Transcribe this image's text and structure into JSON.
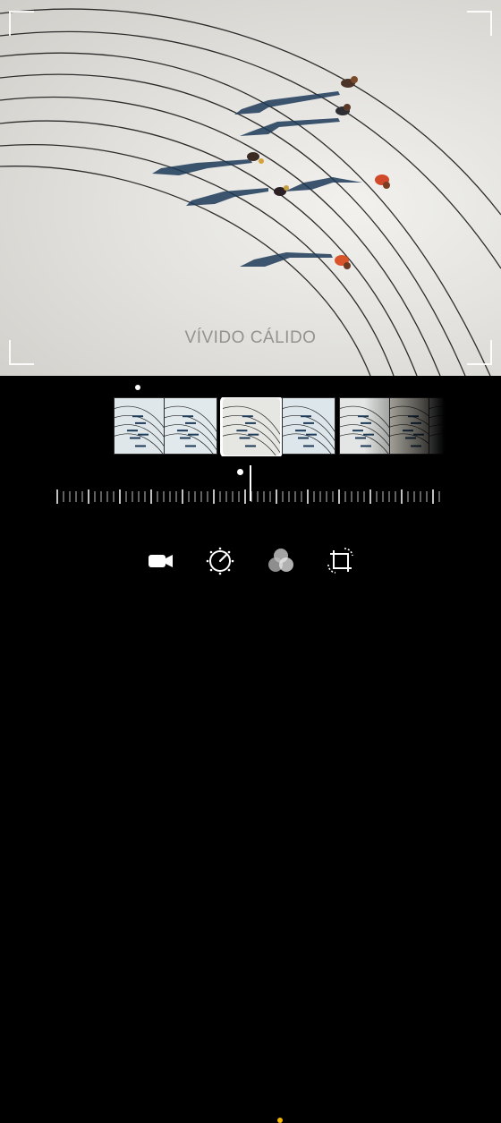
{
  "photo": {
    "filter_label": "VÍVIDO CÁLIDO"
  },
  "filters": {
    "selected_index": 2,
    "thumbnails": [
      {
        "tint": "#dfe7ea"
      },
      {
        "tint": "#e2e9ec"
      },
      {
        "tint": "#e6e6e3"
      },
      {
        "tint": "#dde6ea"
      },
      {
        "tint": "#e3e6e4"
      },
      {
        "tint": "#e6e3d6"
      },
      {
        "tint": "#e2e4e6"
      }
    ]
  },
  "toolbar": {
    "tools": [
      {
        "icon": "video-camera-icon"
      },
      {
        "icon": "adjust-dial-icon"
      },
      {
        "icon": "filters-icon",
        "active": true
      },
      {
        "icon": "crop-rotate-icon"
      }
    ],
    "active_color": "#f5b800"
  }
}
